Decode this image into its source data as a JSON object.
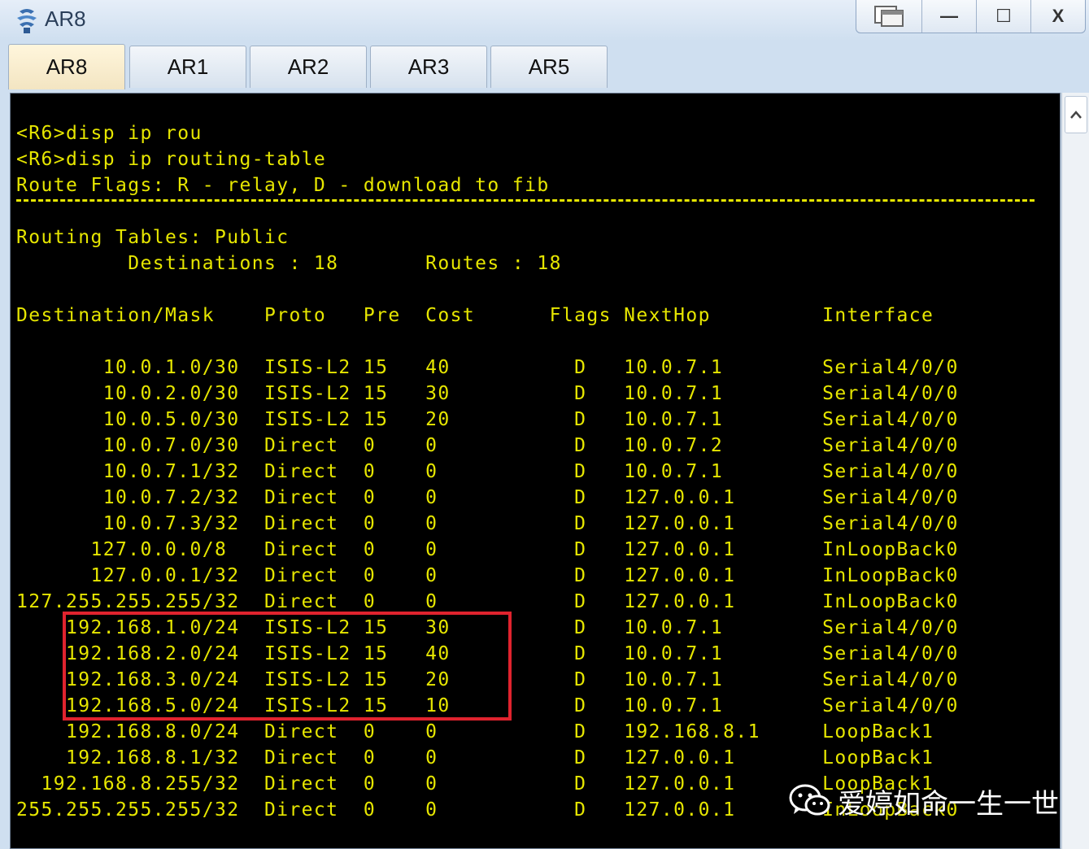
{
  "window": {
    "title": "AR8",
    "buttons": {
      "restore": "restore-icon",
      "minimize": "—",
      "maximize": "☐",
      "close": "X"
    }
  },
  "tabs": [
    {
      "label": "AR8",
      "active": true
    },
    {
      "label": "AR1",
      "active": false
    },
    {
      "label": "AR2",
      "active": false
    },
    {
      "label": "AR3",
      "active": false
    },
    {
      "label": "AR5",
      "active": false
    }
  ],
  "terminal": {
    "text_color": "#e6e600",
    "highlight_color": "#e0232e",
    "lines": [
      "<R6>disp ip rou",
      "<R6>disp ip routing-table",
      "Route Flags: R - relay, D - download to fib",
      "",
      "Routing Tables: Public",
      "         Destinations : 18       Routes : 18",
      "",
      "Destination/Mask    Proto   Pre  Cost      Flags NextHop         Interface",
      "",
      "       10.0.1.0/30  ISIS-L2 15   40          D   10.0.7.1        Serial4/0/0",
      "       10.0.2.0/30  ISIS-L2 15   30          D   10.0.7.1        Serial4/0/0",
      "       10.0.5.0/30  ISIS-L2 15   20          D   10.0.7.1        Serial4/0/0",
      "       10.0.7.0/30  Direct  0    0           D   10.0.7.2        Serial4/0/0",
      "       10.0.7.1/32  Direct  0    0           D   10.0.7.1        Serial4/0/0",
      "       10.0.7.2/32  Direct  0    0           D   127.0.0.1       Serial4/0/0",
      "       10.0.7.3/32  Direct  0    0           D   127.0.0.1       Serial4/0/0",
      "      127.0.0.0/8   Direct  0    0           D   127.0.0.1       InLoopBack0",
      "      127.0.0.1/32  Direct  0    0           D   127.0.0.1       InLoopBack0",
      "127.255.255.255/32  Direct  0    0           D   127.0.0.1       InLoopBack0",
      "    192.168.1.0/24  ISIS-L2 15   30          D   10.0.7.1        Serial4/0/0",
      "    192.168.2.0/24  ISIS-L2 15   40          D   10.0.7.1        Serial4/0/0",
      "    192.168.3.0/24  ISIS-L2 15   20          D   10.0.7.1        Serial4/0/0",
      "    192.168.5.0/24  ISIS-L2 15   10          D   10.0.7.1        Serial4/0/0",
      "    192.168.8.0/24  Direct  0    0           D   192.168.8.1     LoopBack1",
      "    192.168.8.1/32  Direct  0    0           D   127.0.0.1       LoopBack1",
      "  192.168.8.255/32  Direct  0    0           D   127.0.0.1       LoopBack1",
      "255.255.255.255/32  Direct  0    0           D   127.0.0.1       InLoopBack0"
    ]
  },
  "watermark": {
    "text": "爱婷如命一生一世",
    "icon": "wechat-icon"
  }
}
